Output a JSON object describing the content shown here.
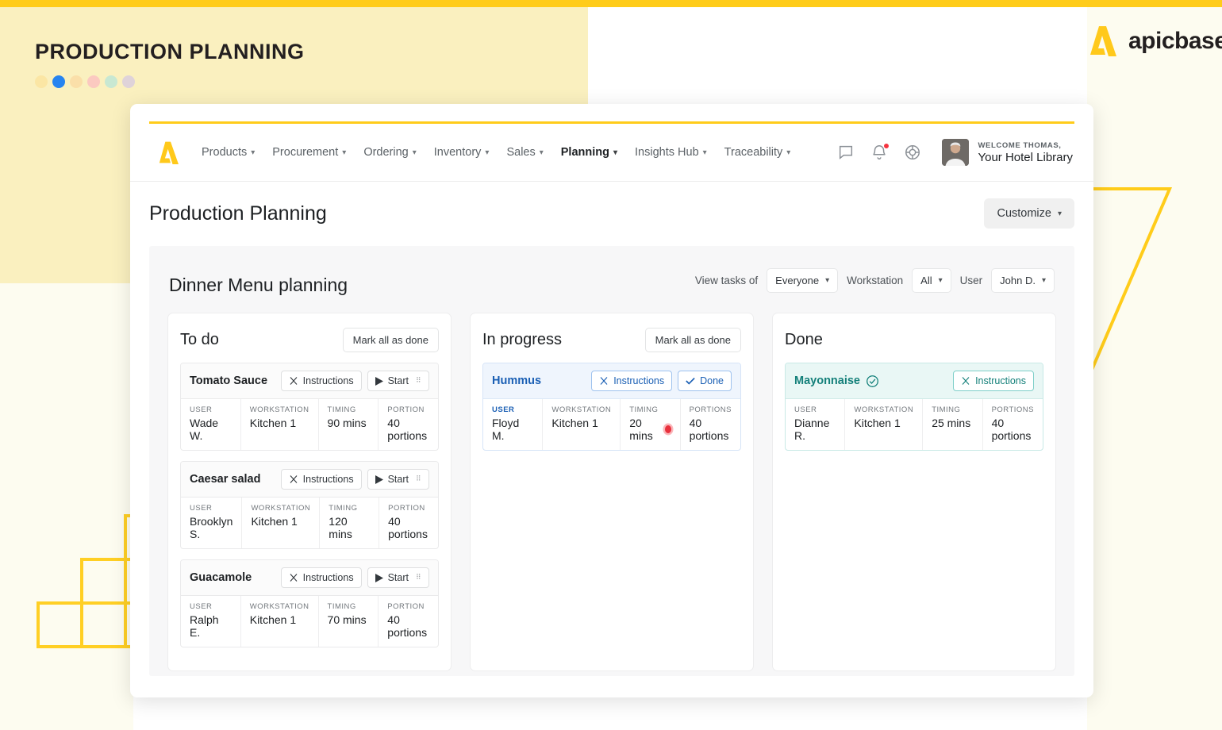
{
  "banner": {
    "title": "PRODUCTION PLANNING",
    "dots": [
      "#fbe6a4",
      "#2684f0",
      "#fadfa9",
      "#fbc9c0",
      "#c8e8d2",
      "#dfd3d9"
    ],
    "logo_text": "apicbase"
  },
  "nav": {
    "links": [
      {
        "label": "Products",
        "active": false,
        "caret": "⌄"
      },
      {
        "label": "Procurement",
        "active": false,
        "caret": "⌄"
      },
      {
        "label": "Ordering",
        "active": false,
        "caret": "⌄"
      },
      {
        "label": "Inventory",
        "active": false,
        "caret": "⌄"
      },
      {
        "label": "Sales",
        "active": false,
        "caret": "⌄"
      },
      {
        "label": "Planning",
        "active": true,
        "caret": "⌄"
      },
      {
        "label": "Insights Hub",
        "active": false,
        "caret": "⌄"
      },
      {
        "label": "Traceability",
        "active": false,
        "caret": "⌄"
      }
    ],
    "icons": [
      "chat-icon",
      "bell-icon",
      "help-icon"
    ],
    "user": {
      "welcome": "WELCOME THOMAS,",
      "library": "Your Hotel Library"
    }
  },
  "page": {
    "title": "Production Planning",
    "customize_label": "Customize"
  },
  "board": {
    "title": "Dinner Menu planning",
    "filters": [
      {
        "label": "View tasks of",
        "value": "Everyone"
      },
      {
        "label": "Workstation",
        "value": "All"
      },
      {
        "label": "User",
        "value": "John D."
      }
    ],
    "mark_all_label": "Mark all as done",
    "labels": {
      "user": "USER",
      "workstation": "WORKSTATION",
      "timing": "TIMING",
      "portion": "PORTION",
      "portions": "PORTIONS"
    },
    "buttons": {
      "instructions": "Instructions",
      "start": "Start",
      "done": "Done"
    },
    "columns": [
      {
        "name": "To do",
        "has_mark_all": true,
        "state": "todo",
        "tasks": [
          {
            "name": "Tomato Sauce",
            "user": "Wade W.",
            "workstation": "Kitchen 1",
            "timing": "90 mins",
            "portion_label": "PORTION",
            "portions": "40 portions"
          },
          {
            "name": "Caesar salad",
            "user": "Brooklyn S.",
            "workstation": "Kitchen 1",
            "timing": "120 mins",
            "portion_label": "PORTION",
            "portions": "40 portions"
          },
          {
            "name": "Guacamole",
            "user": "Ralph E.",
            "workstation": "Kitchen 1",
            "timing": "70 mins",
            "portion_label": "PORTION",
            "portions": "40 portions"
          }
        ]
      },
      {
        "name": "In progress",
        "has_mark_all": true,
        "state": "progress",
        "tasks": [
          {
            "name": "Hummus",
            "user": "Floyd M.",
            "workstation": "Kitchen 1",
            "timing": "20 mins",
            "portion_label": "PORTIONS",
            "portions": "40 portions",
            "recording": true
          }
        ]
      },
      {
        "name": "Done",
        "has_mark_all": false,
        "state": "done",
        "tasks": [
          {
            "name": "Mayonnaise",
            "user": "Dianne R.",
            "workstation": "Kitchen 1",
            "timing": "25 mins",
            "portion_label": "PORTIONS",
            "portions": "40 portions",
            "completed": true
          }
        ]
      }
    ]
  },
  "colors": {
    "brand_yellow": "#ffcc1a",
    "banner_bg": "#faf0bf",
    "progress_blue": "#1a5fb4",
    "done_teal": "#14807a",
    "recording_red": "#e8313d"
  }
}
